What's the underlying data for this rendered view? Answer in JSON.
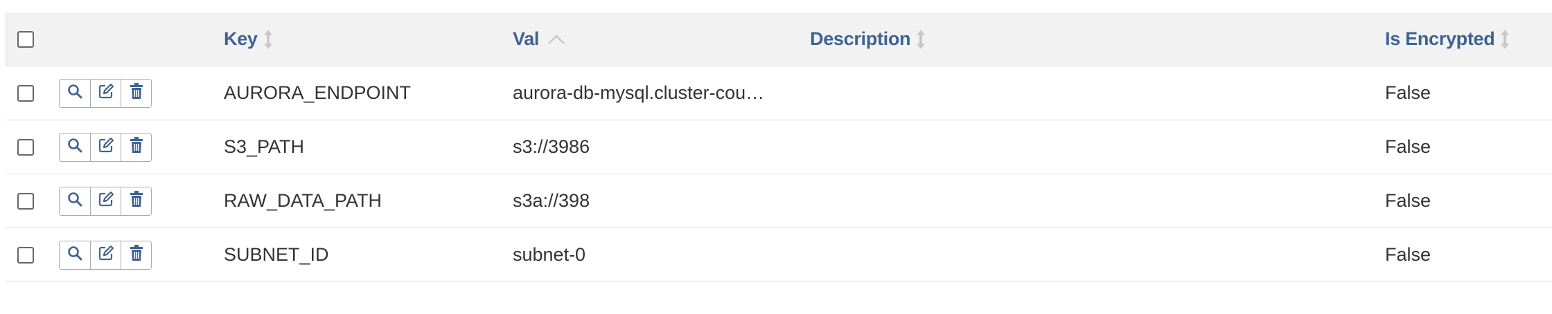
{
  "columns": {
    "key": "Key",
    "val": "Val",
    "description": "Description",
    "is_encrypted": "Is Encrypted"
  },
  "sort": {
    "column": "val",
    "direction": "ascending"
  },
  "icons": {
    "view": "search-icon",
    "edit": "edit-icon",
    "delete": "trash-icon",
    "sort": "sort-icon",
    "sort_asc": "chevron-up-icon"
  },
  "colors": {
    "header_text": "#3e6392",
    "action_icon": "#3e6392",
    "header_bg": "#f2f2f2"
  },
  "rows": [
    {
      "key": "AURORA_ENDPOINT",
      "val": "aurora-db-mysql.cluster-cou…",
      "description": "",
      "is_encrypted": "False"
    },
    {
      "key": "S3_PATH",
      "val": "s3://3986",
      "description": "",
      "is_encrypted": "False"
    },
    {
      "key": "RAW_DATA_PATH",
      "val": "s3a://398",
      "description": "",
      "is_encrypted": "False"
    },
    {
      "key": "SUBNET_ID",
      "val": "subnet-0",
      "description": "",
      "is_encrypted": "False"
    }
  ]
}
